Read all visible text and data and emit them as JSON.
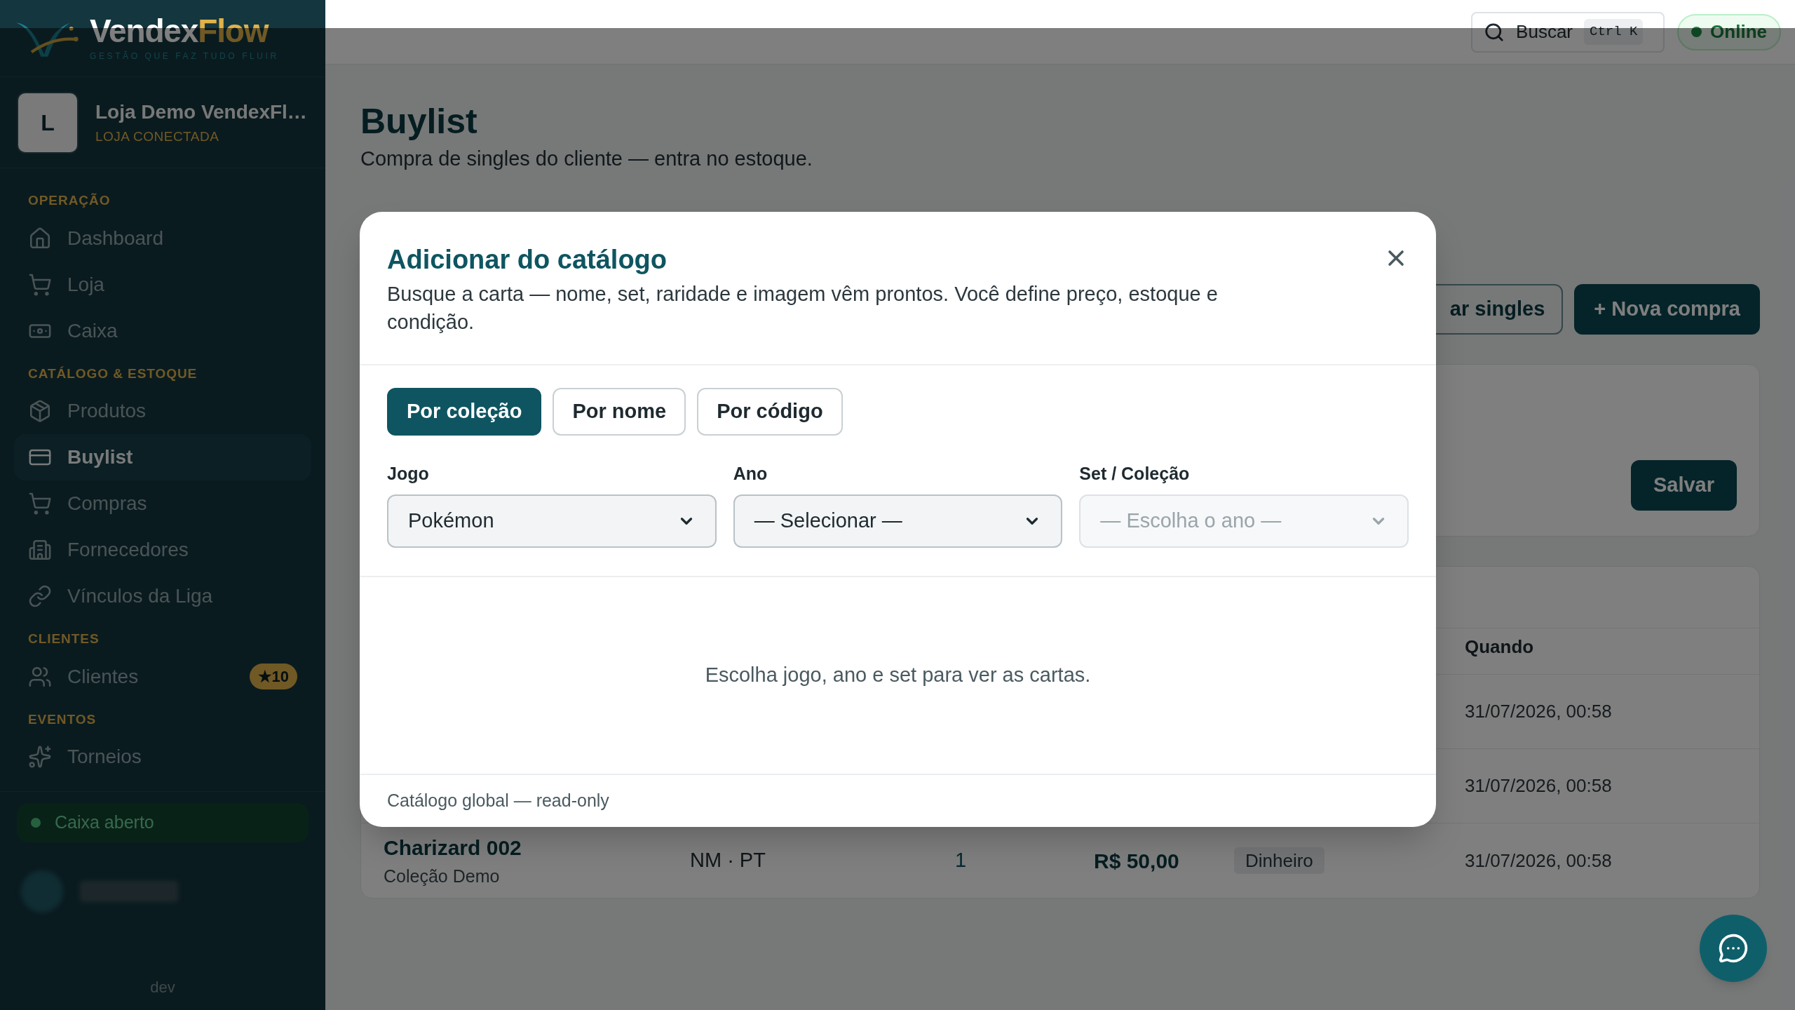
{
  "brand": {
    "name_a": "Vendex",
    "name_b": "Flow",
    "tagline": "GESTÃO QUE FAZ TUDO FLUIR"
  },
  "store": {
    "initial": "L",
    "name": "Loja Demo VendexFl…",
    "status": "LOJA CONECTADA"
  },
  "sidebar": {
    "sections": [
      {
        "title": "OPERAÇÃO",
        "items": [
          {
            "label": "Dashboard",
            "selected": false
          },
          {
            "label": "Loja",
            "selected": false
          },
          {
            "label": "Caixa",
            "selected": false
          }
        ]
      },
      {
        "title": "CATÁLOGO & ESTOQUE",
        "items": [
          {
            "label": "Produtos",
            "selected": false
          },
          {
            "label": "Buylist",
            "selected": true
          },
          {
            "label": "Compras",
            "selected": false
          },
          {
            "label": "Fornecedores",
            "selected": false
          },
          {
            "label": "Vínculos da Liga",
            "selected": false
          }
        ]
      },
      {
        "title": "CLIENTES",
        "items": [
          {
            "label": "Clientes",
            "selected": false,
            "badge": "★10"
          }
        ]
      },
      {
        "title": "EVENTOS",
        "items": [
          {
            "label": "Torneios",
            "selected": false
          }
        ]
      }
    ],
    "cash_status": {
      "label": "Caixa aberto",
      "open": true
    },
    "footer": "dev"
  },
  "topbar": {
    "search": {
      "label": "Buscar",
      "shortcut": "Ctrl K"
    },
    "connection": {
      "label": "Online",
      "online": true
    }
  },
  "page": {
    "title": "Buylist",
    "subtitle": "Compra de singles do cliente — entra no estoque.",
    "buttons": [
      {
        "label": "ar singles",
        "kind": "outline"
      },
      {
        "label": "+ Nova compra",
        "kind": "primary"
      }
    ],
    "form_card": {
      "save": "Salvar"
    },
    "table": {
      "columns": [
        {
          "label": "Quando"
        }
      ],
      "rows": [
        {
          "when": "31/07/2026, 00:58"
        },
        {
          "when": "31/07/2026, 00:58"
        },
        {
          "card": "Charizard 002",
          "collection": "Coleção Demo",
          "condition": "NM · PT",
          "qty": "1",
          "price": "R$ 50,00",
          "payment": "Dinheiro",
          "when": "31/07/2026, 00:58"
        }
      ]
    }
  },
  "modal": {
    "title": "Adicionar do catálogo",
    "subtitle": "Busque a carta — nome, set, raridade e imagem vêm prontos. Você define preço, estoque e condição.",
    "tabs": [
      {
        "label": "Por coleção",
        "selected": true
      },
      {
        "label": "Por nome",
        "selected": false
      },
      {
        "label": "Por código",
        "selected": false
      }
    ],
    "fields": [
      {
        "label": "Jogo",
        "value": "Pokémon",
        "disabled": false
      },
      {
        "label": "Ano",
        "value": "— Selecionar —",
        "disabled": false
      },
      {
        "label": "Set / Coleção",
        "placeholder": "— Escolha o ano —",
        "disabled": true
      }
    ],
    "empty_message": "Escolha jogo, ano e set para ver as cartas.",
    "footer": "Catálogo global — read-only"
  }
}
